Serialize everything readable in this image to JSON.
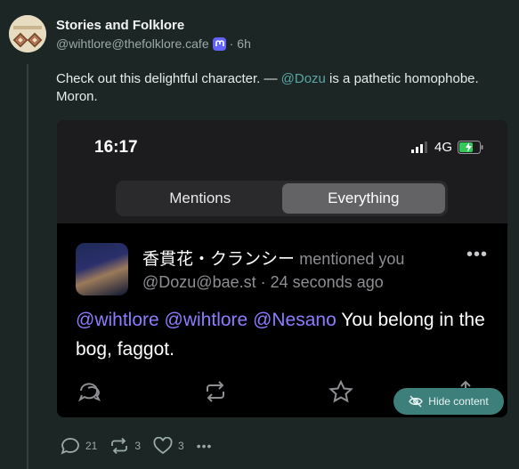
{
  "post": {
    "display_name": "Stories and Folklore",
    "handle": "@wihtlore@thefolklore.cafe",
    "time": "6h",
    "separator": "·",
    "text_before": "Check out this delightful character. — ",
    "mention": "@Dozu",
    "text_after": " is a pathetic homophobe. Moron."
  },
  "embedded_screenshot": {
    "clock": "16:17",
    "network": "4G",
    "tabs": [
      {
        "label": "Mentions",
        "active": false
      },
      {
        "label": "Everything",
        "active": true
      }
    ],
    "notification": {
      "name": "香貫花・クランシー",
      "action": "mentioned you",
      "handle": "@Dozu@bae.st",
      "separator": "·",
      "age": "24 seconds ago",
      "mentions": [
        "@wihtlore",
        "@wihtlore",
        "@Nesano"
      ],
      "text": "You belong in the bog, faggot."
    }
  },
  "hide_content": "Hide content",
  "actions": {
    "replies": "21",
    "boosts": "3",
    "favourites": "3",
    "more": "•••"
  },
  "colors": {
    "background": "#1b2625",
    "mention": "#5ba6a5",
    "pill": "#3d7f7a",
    "embedded_mention": "#8c7dff"
  }
}
